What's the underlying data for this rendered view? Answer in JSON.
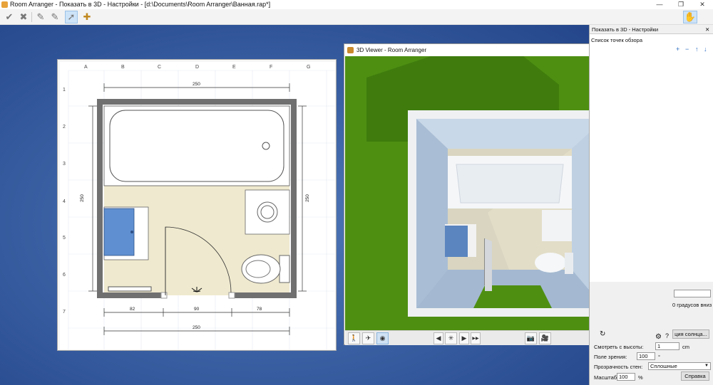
{
  "window": {
    "title": "Room Arranger - Показать в 3D - Настройки - [d:\\Documents\\Room Arranger\\Ванная.rap*]",
    "minimize": "—",
    "restore": "❐",
    "close": "✕"
  },
  "toolbar": {
    "check": "✔",
    "cross": "✖",
    "tool1": "✎",
    "tool2": "✎",
    "pointer": "➚",
    "add": "✚",
    "hand": "✋"
  },
  "plan": {
    "columns": [
      "A",
      "B",
      "C",
      "D",
      "E",
      "F",
      "G"
    ],
    "rows": [
      "1",
      "2",
      "3",
      "4",
      "5",
      "6",
      "7"
    ],
    "dim_top": "250",
    "dim_bottom": "250",
    "dim_left": "250",
    "dim_right": "250",
    "dim_door_left": "82",
    "dim_door_mid": "90",
    "dim_door_right": "78"
  },
  "viewer": {
    "title": "3D Viewer - Room Arranger",
    "minimize": "—",
    "maximize": "☐",
    "close": "✕",
    "buttons": {
      "walk": "🚶",
      "fly": "✈",
      "look": "◉",
      "prev": "◀",
      "spin": "✳",
      "play": "▶",
      "fast": "▶▶",
      "camera": "📷",
      "video": "🎥"
    }
  },
  "panel": {
    "title": "Показать в 3D - Настройки",
    "close": "✕",
    "list_label": "Список точек обзора",
    "list_add": "+",
    "list_remove": "−",
    "list_up": "↑",
    "list_down": "↓",
    "sun_text": "0 градусов вниз",
    "sun_button": "ция солнца...",
    "height_label": "Смотреть с высоты:",
    "height_value": "1",
    "height_unit": "cm",
    "fov_label": "Поле зрения:",
    "fov_value": "100",
    "fov_unit": "°",
    "transparency_label": "Прозрачность стен:",
    "transparency_value": "Сплошные",
    "scale_label": "Масштаб:",
    "scale_value": "100",
    "scale_unit": "%",
    "help_button": "Справка",
    "gear": "⚙",
    "question": "?"
  }
}
